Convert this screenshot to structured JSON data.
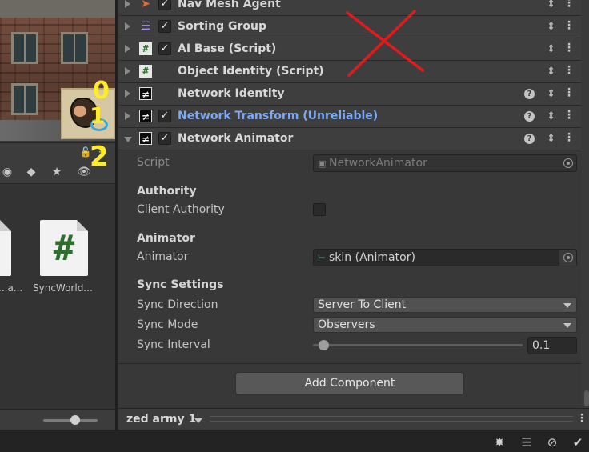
{
  "annotations": {
    "numbers": [
      "0",
      "1",
      "2"
    ]
  },
  "project": {
    "assets": [
      {
        "label": "...a...",
        "icon": "script-asset-icon"
      },
      {
        "label": "SyncWorld...",
        "icon": "script-asset-icon"
      }
    ]
  },
  "inspector": {
    "components": [
      {
        "name": "Nav Mesh Agent",
        "icon": "nav-mesh-agent-icon",
        "checked": true
      },
      {
        "name": "Sorting Group",
        "icon": "sorting-group-icon",
        "checked": true
      },
      {
        "name": "AI Base (Script)",
        "icon": "script-icon",
        "checked": true
      },
      {
        "name": "Object Identity (Script)",
        "icon": "script-icon",
        "checked": false
      },
      {
        "name": "Network Identity",
        "icon": "network-component-icon",
        "checked": false
      },
      {
        "name": "Network Transform (Unreliable)",
        "icon": "network-component-icon",
        "checked": true
      },
      {
        "name": "Network Animator",
        "icon": "network-component-icon",
        "checked": true
      }
    ],
    "animator_component": {
      "script_label": "Script",
      "script_value": "NetworkAnimator",
      "authority_header": "Authority",
      "client_authority_label": "Client Authority",
      "client_authority_value": false,
      "animator_header": "Animator",
      "animator_label": "Animator",
      "animator_value": "skin (Animator)",
      "sync_header": "Sync Settings",
      "sync_direction_label": "Sync Direction",
      "sync_direction_value": "Server To Client",
      "sync_mode_label": "Sync Mode",
      "sync_mode_value": "Observers",
      "sync_interval_label": "Sync Interval",
      "sync_interval_value": "0.1",
      "sync_interval_slider_fraction": 0.05
    },
    "add_component_label": "Add Component"
  },
  "footer": {
    "layer_name": "zed army 1"
  },
  "colors": {
    "annotation_red": "#e01b1b",
    "annotation_yellow": "#ffeb2a",
    "link_blue": "#7eaaf2"
  }
}
